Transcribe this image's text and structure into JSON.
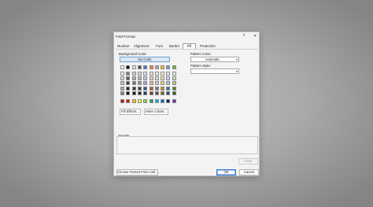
{
  "dialog": {
    "title": "Find Format",
    "help_glyph": "?",
    "close_glyph": "✕"
  },
  "tabs": [
    {
      "label": "Number",
      "active": false
    },
    {
      "label": "Alignment",
      "active": false
    },
    {
      "label": "Font",
      "active": false
    },
    {
      "label": "Border",
      "active": false
    },
    {
      "label": "Fill",
      "active": true
    },
    {
      "label": "Protection",
      "active": false
    }
  ],
  "fill": {
    "background_color_label": "Background Color:",
    "no_color_label": "No Color",
    "fill_effects_label": "Fill Effects...",
    "more_colors_label": "More Colors...",
    "pattern_color_label": "Pattern Color:",
    "pattern_color_value": "Automatic",
    "pattern_style_label": "Pattern Style:",
    "pattern_style_value": ""
  },
  "palette": {
    "theme_rows": [
      [
        "#ffffff",
        "#000000",
        "#e7e6e6",
        "#44546a",
        "#4472c4",
        "#ed7d31",
        "#a5a5a5",
        "#ffc000",
        "#5b9bd5",
        "#70ad47"
      ],
      [
        "#f2f2f2",
        "#7f7f7f",
        "#d0cece",
        "#d6dce4",
        "#d9e2f3",
        "#fbe5d5",
        "#ededed",
        "#fff2cc",
        "#deebf6",
        "#e2efd9"
      ],
      [
        "#d8d8d8",
        "#595959",
        "#aeaaaa",
        "#adb9ca",
        "#b4c6e7",
        "#f7cbac",
        "#dbdbdb",
        "#fee599",
        "#bdd7ee",
        "#c5e0b3"
      ],
      [
        "#bfbfbf",
        "#3f3f3f",
        "#757070",
        "#8496b0",
        "#8eaadb",
        "#f4b183",
        "#c9c9c9",
        "#ffd965",
        "#9dc3e6",
        "#a8d08d"
      ],
      [
        "#a5a5a5",
        "#262626",
        "#3a3838",
        "#323f4f",
        "#2f5496",
        "#c55a11",
        "#7b7b7b",
        "#bf8f00",
        "#2e75b5",
        "#538135"
      ],
      [
        "#7f7f7f",
        "#0c0c0c",
        "#171616",
        "#222a35",
        "#1f3864",
        "#833c0b",
        "#525252",
        "#7f6000",
        "#1e4e79",
        "#375623"
      ]
    ],
    "standard_row": [
      "#c00000",
      "#ff0000",
      "#ffc000",
      "#ffff00",
      "#92d050",
      "#00b050",
      "#00b0f0",
      "#0070c0",
      "#002060",
      "#7030a0"
    ]
  },
  "sample": {
    "label": "Sample"
  },
  "footer": {
    "clear_label": "Clear",
    "choose_format_label": "Choose Format From Cell...",
    "ok_label": "OK",
    "cancel_label": "Cancel"
  }
}
